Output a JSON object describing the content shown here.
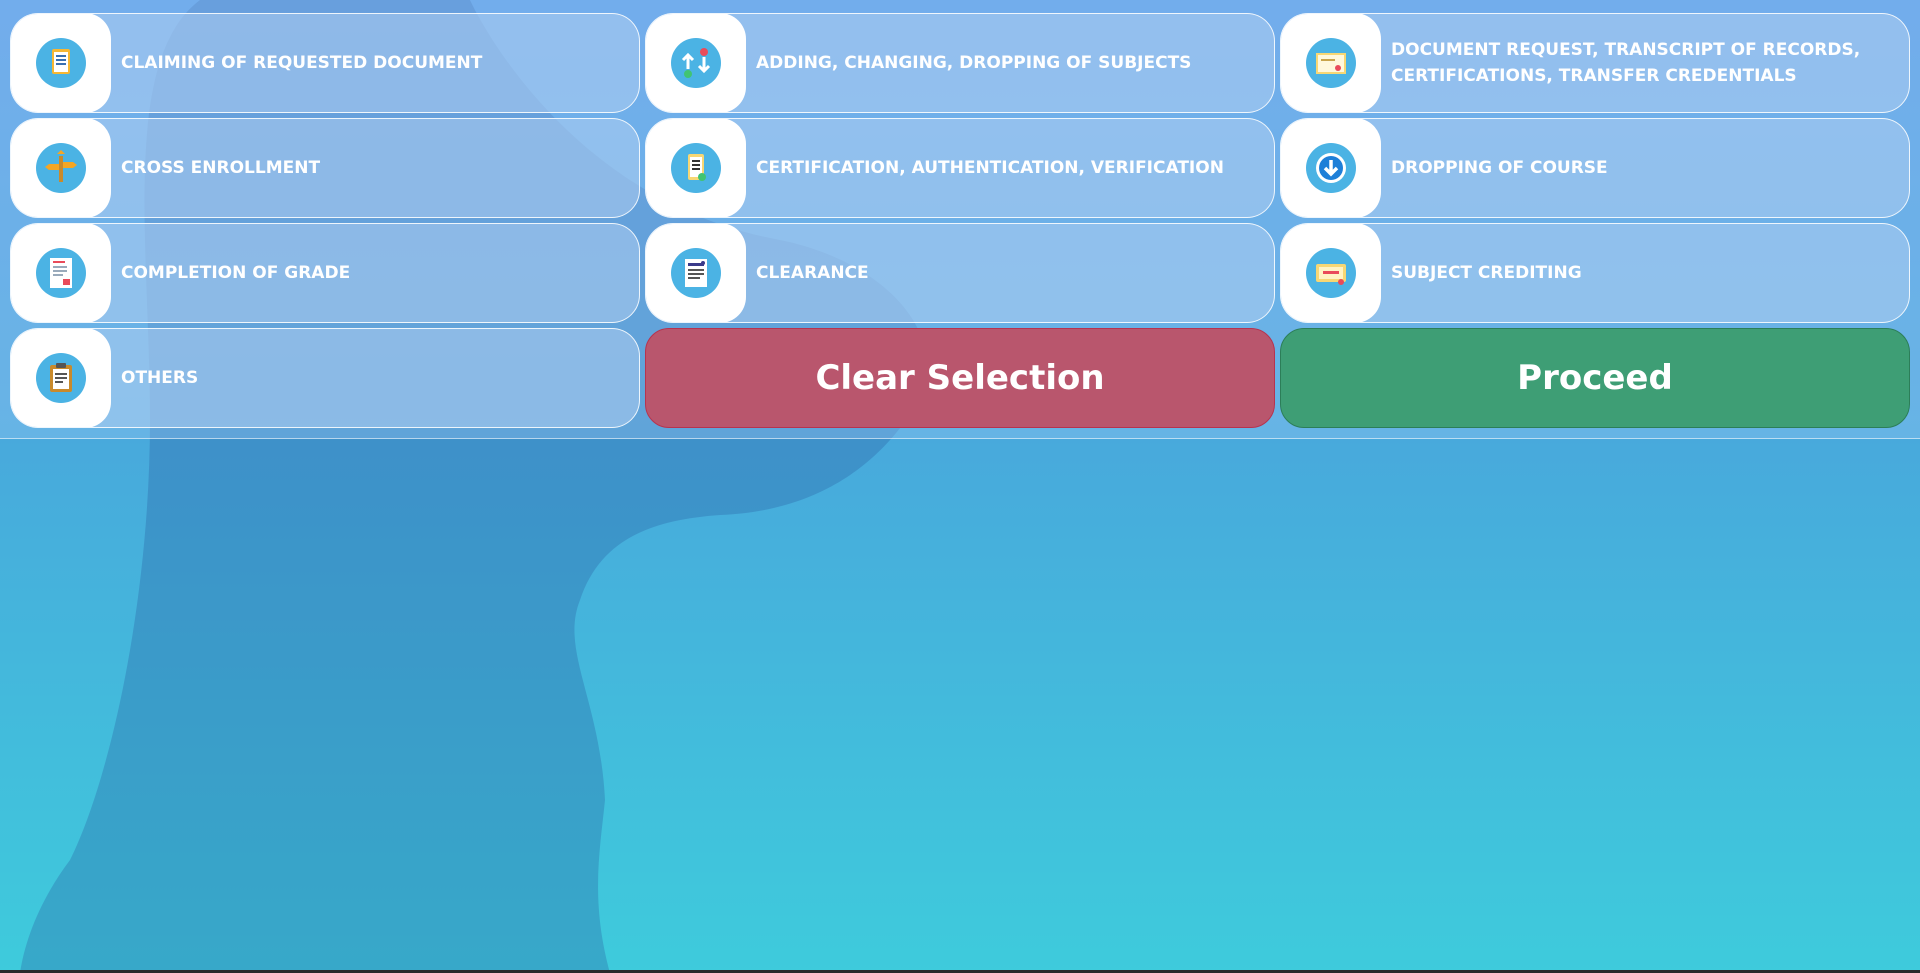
{
  "services": [
    {
      "label": "CLAIMING OF REQUESTED DOCUMENT",
      "icon": "document-icon"
    },
    {
      "label": "ADDING, CHANGING, DROPPING OF SUBJECTS",
      "icon": "swap-arrows-icon"
    },
    {
      "label": "DOCUMENT REQUEST, TRANSCRIPT OF RECORDS, CERTIFICATIONS, TRANSFER CREDENTIALS",
      "icon": "certificate-icon"
    },
    {
      "label": "CROSS ENROLLMENT",
      "icon": "crossroads-icon"
    },
    {
      "label": "CERTIFICATION, AUTHENTICATION, VERIFICATION",
      "icon": "verified-document-icon"
    },
    {
      "label": "DROPPING OF COURSE",
      "icon": "download-arrow-icon"
    },
    {
      "label": "COMPLETION OF GRADE",
      "icon": "grade-paper-icon"
    },
    {
      "label": "CLEARANCE",
      "icon": "clearance-form-icon"
    },
    {
      "label": "SUBJECT CREDITING",
      "icon": "credit-card-icon"
    },
    {
      "label": "OTHERS",
      "icon": "clipboard-icon"
    }
  ],
  "buttons": {
    "clear_label": "Clear Selection",
    "proceed_label": "Proceed"
  },
  "colors": {
    "clear": "#b9566d",
    "proceed": "#3e9e75",
    "icon_circle": "#4bb3e4"
  }
}
